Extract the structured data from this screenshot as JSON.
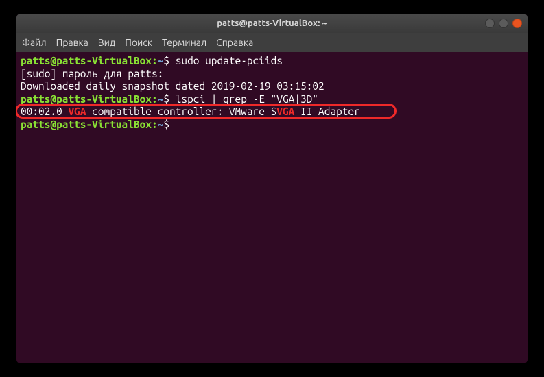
{
  "window": {
    "title": "patts@patts-VirtualBox: ~"
  },
  "menubar": {
    "items": [
      "Файл",
      "Правка",
      "Вид",
      "Поиск",
      "Терминал",
      "Справка"
    ]
  },
  "terminal": {
    "prompt_user": "patts@patts-VirtualBox",
    "prompt_sep": ":",
    "prompt_path": "~",
    "prompt_end": "$ ",
    "line1_cmd": "sudo update-pciids",
    "line2_output": "[sudo] пароль для patts:",
    "line3_output": "Downloaded daily snapshot dated 2019-02-19 03:15:02",
    "line4_cmd": "lspci | grep -E \"VGA|3D\"",
    "line5": {
      "pre1": "00:02.0 ",
      "match1": "VGA",
      "mid1": " compatible controller: VMware S",
      "match2": "VGA",
      "post1": " II Adapter"
    }
  },
  "controls": {
    "minimize": "minimize",
    "maximize": "maximize",
    "close": "close"
  }
}
